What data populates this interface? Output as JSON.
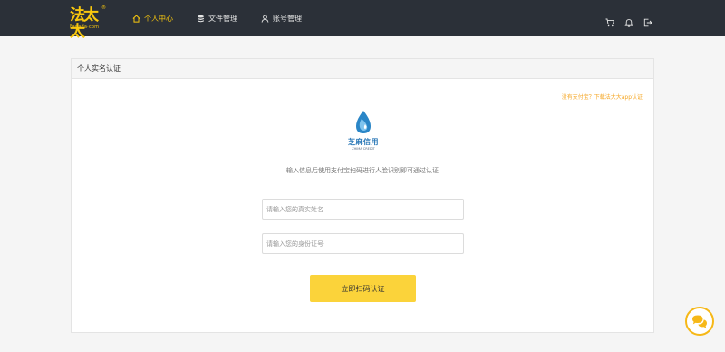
{
  "brand": {
    "logo_text": "法太太",
    "logo_subtext": "Fadada·com",
    "registered_mark": "®",
    "accent_color": "#f9c80e"
  },
  "nav": {
    "items": [
      {
        "label": "个人中心",
        "icon": "home-icon",
        "active": true
      },
      {
        "label": "文件管理",
        "icon": "database-icon",
        "active": false
      },
      {
        "label": "账号管理",
        "icon": "user-icon",
        "active": false
      }
    ],
    "right_icons": [
      "cart-icon",
      "bell-icon",
      "logout-icon"
    ]
  },
  "card": {
    "title": "个人实名认证",
    "help_link": "没有支付宝？下载法大大app认证",
    "provider": {
      "name": "芝麻信用",
      "name_en": "ZHIMA CREDIT"
    },
    "description": "输入信息后使用支付宝扫码进行人脸识别即可通过认证",
    "fields": {
      "name_placeholder": "请输入您的真实姓名",
      "id_placeholder": "请输入您的身份证号"
    },
    "submit_label": "立即扫码认证"
  },
  "chat": {
    "icon": "chat-icon",
    "color": "#f6b817"
  }
}
